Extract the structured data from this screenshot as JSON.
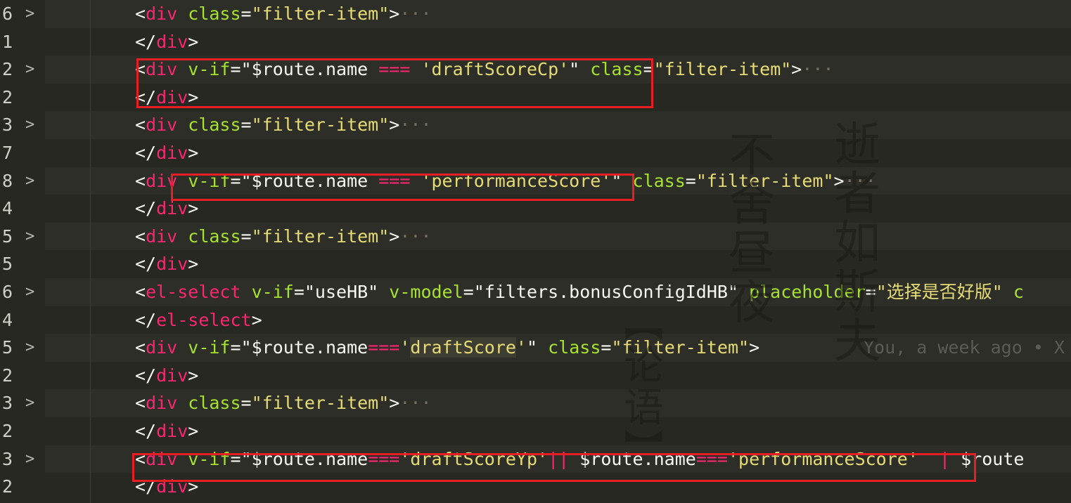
{
  "lines": [
    {
      "ln": "6",
      "fold": ">",
      "segs": [
        [
          "<",
          "p"
        ],
        [
          "div",
          "t"
        ],
        [
          " ",
          "w"
        ],
        [
          "class",
          "a"
        ],
        [
          "=",
          "p"
        ],
        [
          "\"filter-item\"",
          "s"
        ],
        [
          ">",
          "p"
        ],
        [
          "···",
          "dim"
        ]
      ]
    },
    {
      "ln": "1",
      "fold": "",
      "segs": [
        [
          "</",
          "p"
        ],
        [
          "div",
          "t"
        ],
        [
          ">",
          "p"
        ]
      ]
    },
    {
      "ln": "2",
      "fold": ">",
      "segs": [
        [
          "<",
          "p"
        ],
        [
          "div",
          "t"
        ],
        [
          " ",
          "w"
        ],
        [
          "v-if",
          "a"
        ],
        [
          "=",
          "p"
        ],
        [
          "\"$route.name ",
          "w"
        ],
        [
          "===",
          "op"
        ],
        [
          " ",
          "w"
        ],
        [
          "'draftScoreCp'",
          "s"
        ],
        [
          "\"",
          "w"
        ],
        [
          " ",
          "w"
        ],
        [
          "class",
          "a"
        ],
        [
          "=",
          "p"
        ],
        [
          "\"filter-item\"",
          "s"
        ],
        [
          ">",
          "p"
        ],
        [
          "···",
          "dim"
        ]
      ]
    },
    {
      "ln": "2",
      "fold": "",
      "segs": [
        [
          "</",
          "p"
        ],
        [
          "div",
          "t"
        ],
        [
          ">",
          "p"
        ]
      ]
    },
    {
      "ln": "3",
      "fold": ">",
      "segs": [
        [
          "<",
          "p"
        ],
        [
          "div",
          "t"
        ],
        [
          " ",
          "w"
        ],
        [
          "class",
          "a"
        ],
        [
          "=",
          "p"
        ],
        [
          "\"filter-item\"",
          "s"
        ],
        [
          ">",
          "p"
        ],
        [
          "···",
          "dim"
        ]
      ]
    },
    {
      "ln": "7",
      "fold": "",
      "segs": [
        [
          "</",
          "p"
        ],
        [
          "div",
          "t"
        ],
        [
          ">",
          "p"
        ]
      ]
    },
    {
      "ln": "8",
      "fold": ">",
      "segs": [
        [
          "<",
          "p"
        ],
        [
          "div",
          "t"
        ],
        [
          " ",
          "w"
        ],
        [
          "v-if",
          "a"
        ],
        [
          "=",
          "p"
        ],
        [
          "\"$route.name ",
          "w"
        ],
        [
          "===",
          "op"
        ],
        [
          " ",
          "w"
        ],
        [
          "'performanceScore'",
          "s"
        ],
        [
          "\"",
          "w"
        ],
        [
          " ",
          "w"
        ],
        [
          "class",
          "a"
        ],
        [
          "=",
          "p"
        ],
        [
          "\"filter-item\"",
          "s"
        ],
        [
          ">",
          "p"
        ],
        [
          "···",
          "dim"
        ]
      ]
    },
    {
      "ln": "4",
      "fold": "",
      "segs": [
        [
          "</",
          "p"
        ],
        [
          "div",
          "t"
        ],
        [
          ">",
          "p"
        ]
      ]
    },
    {
      "ln": "5",
      "fold": ">",
      "segs": [
        [
          "<",
          "p"
        ],
        [
          "div",
          "t"
        ],
        [
          " ",
          "w"
        ],
        [
          "class",
          "a"
        ],
        [
          "=",
          "p"
        ],
        [
          "\"filter-item\"",
          "s"
        ],
        [
          ">",
          "p"
        ],
        [
          "···",
          "dim"
        ]
      ]
    },
    {
      "ln": "5",
      "fold": "",
      "segs": [
        [
          "</",
          "p"
        ],
        [
          "div",
          "t"
        ],
        [
          ">",
          "p"
        ]
      ]
    },
    {
      "ln": "6",
      "fold": ">",
      "segs": [
        [
          "<",
          "p"
        ],
        [
          "el-select",
          "t"
        ],
        [
          " ",
          "w"
        ],
        [
          "v-if",
          "a"
        ],
        [
          "=",
          "p"
        ],
        [
          "\"useHB\"",
          "w"
        ],
        [
          " ",
          "w"
        ],
        [
          "v-model",
          "a"
        ],
        [
          "=",
          "p"
        ],
        [
          "\"filters.bonusConfigIdHB\"",
          "w"
        ],
        [
          " ",
          "w"
        ],
        [
          "placeholder",
          "a"
        ],
        [
          "=",
          "p"
        ],
        [
          "\"选择是否好版\"",
          "s"
        ],
        [
          " ",
          "w"
        ],
        [
          "c",
          "a"
        ]
      ]
    },
    {
      "ln": "4",
      "fold": "",
      "segs": [
        [
          "</",
          "p"
        ],
        [
          "el-select",
          "t"
        ],
        [
          ">",
          "p"
        ]
      ]
    },
    {
      "ln": "5",
      "fold": ">",
      "segs": [
        [
          "<",
          "p"
        ],
        [
          "div",
          "t"
        ],
        [
          " ",
          "w"
        ],
        [
          "v-if",
          "a"
        ],
        [
          "=",
          "p"
        ],
        [
          "\"$route.name",
          "w"
        ],
        [
          "===",
          "op"
        ],
        [
          "'",
          "s"
        ],
        [
          "draftScore",
          "s match"
        ],
        [
          "'",
          "s"
        ],
        [
          "\"",
          "w"
        ],
        [
          " ",
          "w"
        ],
        [
          "class",
          "a"
        ],
        [
          "=",
          "p"
        ],
        [
          "\"filter-item\"",
          "s"
        ],
        [
          ">",
          "p"
        ]
      ],
      "blame": "You, a week ago • X"
    },
    {
      "ln": "2",
      "fold": "",
      "segs": [
        [
          "</",
          "p"
        ],
        [
          "div",
          "t"
        ],
        [
          ">",
          "p"
        ]
      ]
    },
    {
      "ln": "3",
      "fold": ">",
      "segs": [
        [
          "<",
          "p"
        ],
        [
          "div",
          "t"
        ],
        [
          " ",
          "w"
        ],
        [
          "class",
          "a"
        ],
        [
          "=",
          "p"
        ],
        [
          "\"filter-item\"",
          "s"
        ],
        [
          ">",
          "p"
        ],
        [
          "···",
          "dim"
        ]
      ]
    },
    {
      "ln": "2",
      "fold": "",
      "segs": [
        [
          "</",
          "p"
        ],
        [
          "div",
          "t"
        ],
        [
          ">",
          "p"
        ]
      ]
    },
    {
      "ln": "3",
      "fold": ">",
      "segs": [
        [
          "<",
          "p"
        ],
        [
          "div",
          "t"
        ],
        [
          " ",
          "w"
        ],
        [
          "v-if",
          "a"
        ],
        [
          "=",
          "p"
        ],
        [
          "\"$route.name",
          "w"
        ],
        [
          "===",
          "op"
        ],
        [
          "'draftScoreYp'",
          "s"
        ],
        [
          "||",
          "op"
        ],
        [
          " ",
          "w"
        ],
        [
          "$route.name",
          "w"
        ],
        [
          "===",
          "op"
        ],
        [
          "'performanceScore'",
          "s"
        ],
        [
          "  ",
          "w"
        ],
        [
          "|",
          "op"
        ],
        [
          " ",
          "w"
        ],
        [
          "$route",
          "w"
        ]
      ]
    },
    {
      "ln": "2",
      "fold": "",
      "segs": [
        [
          "</",
          "p"
        ],
        [
          "div",
          "t"
        ],
        [
          ">",
          "p"
        ]
      ]
    }
  ],
  "watermark": {
    "col1": "逝者如斯夫",
    "col2": "不舍昼夜",
    "col3": "【论语】"
  }
}
